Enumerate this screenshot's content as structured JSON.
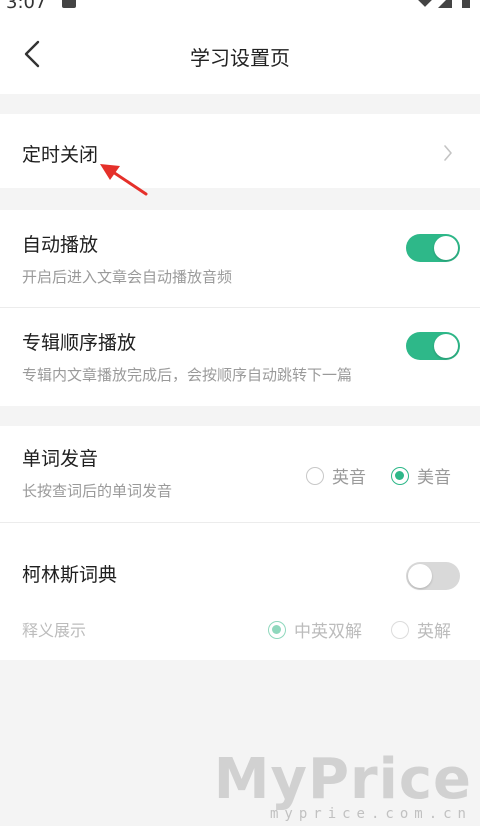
{
  "status_bar": {
    "time": "3:07"
  },
  "header": {
    "title": "学习设置页"
  },
  "timer_close": {
    "label": "定时关闭"
  },
  "auto_play": {
    "label": "自动播放",
    "description": "开启后进入文章会自动播放音频",
    "enabled": true
  },
  "album_order_play": {
    "label": "专辑顺序播放",
    "description": "专辑内文章播放完成后，会按顺序自动跳转下一篇",
    "enabled": true
  },
  "word_pronunciation": {
    "label": "单词发音",
    "description": "长按查词后的单词发音",
    "options": [
      {
        "label": "英音",
        "selected": false
      },
      {
        "label": "美音",
        "selected": true
      }
    ]
  },
  "collins_dictionary": {
    "label": "柯林斯词典",
    "enabled": false,
    "definition_label": "释义展示",
    "definition_options": [
      {
        "label": "中英双解",
        "selected": true
      },
      {
        "label": "英解",
        "selected": false
      }
    ]
  },
  "watermark": {
    "brand": "MyPrice",
    "url": "myprice.com.cn"
  },
  "colors": {
    "accent": "#2eb889",
    "arrow": "#e5302a",
    "background": "#f4f4f4"
  }
}
